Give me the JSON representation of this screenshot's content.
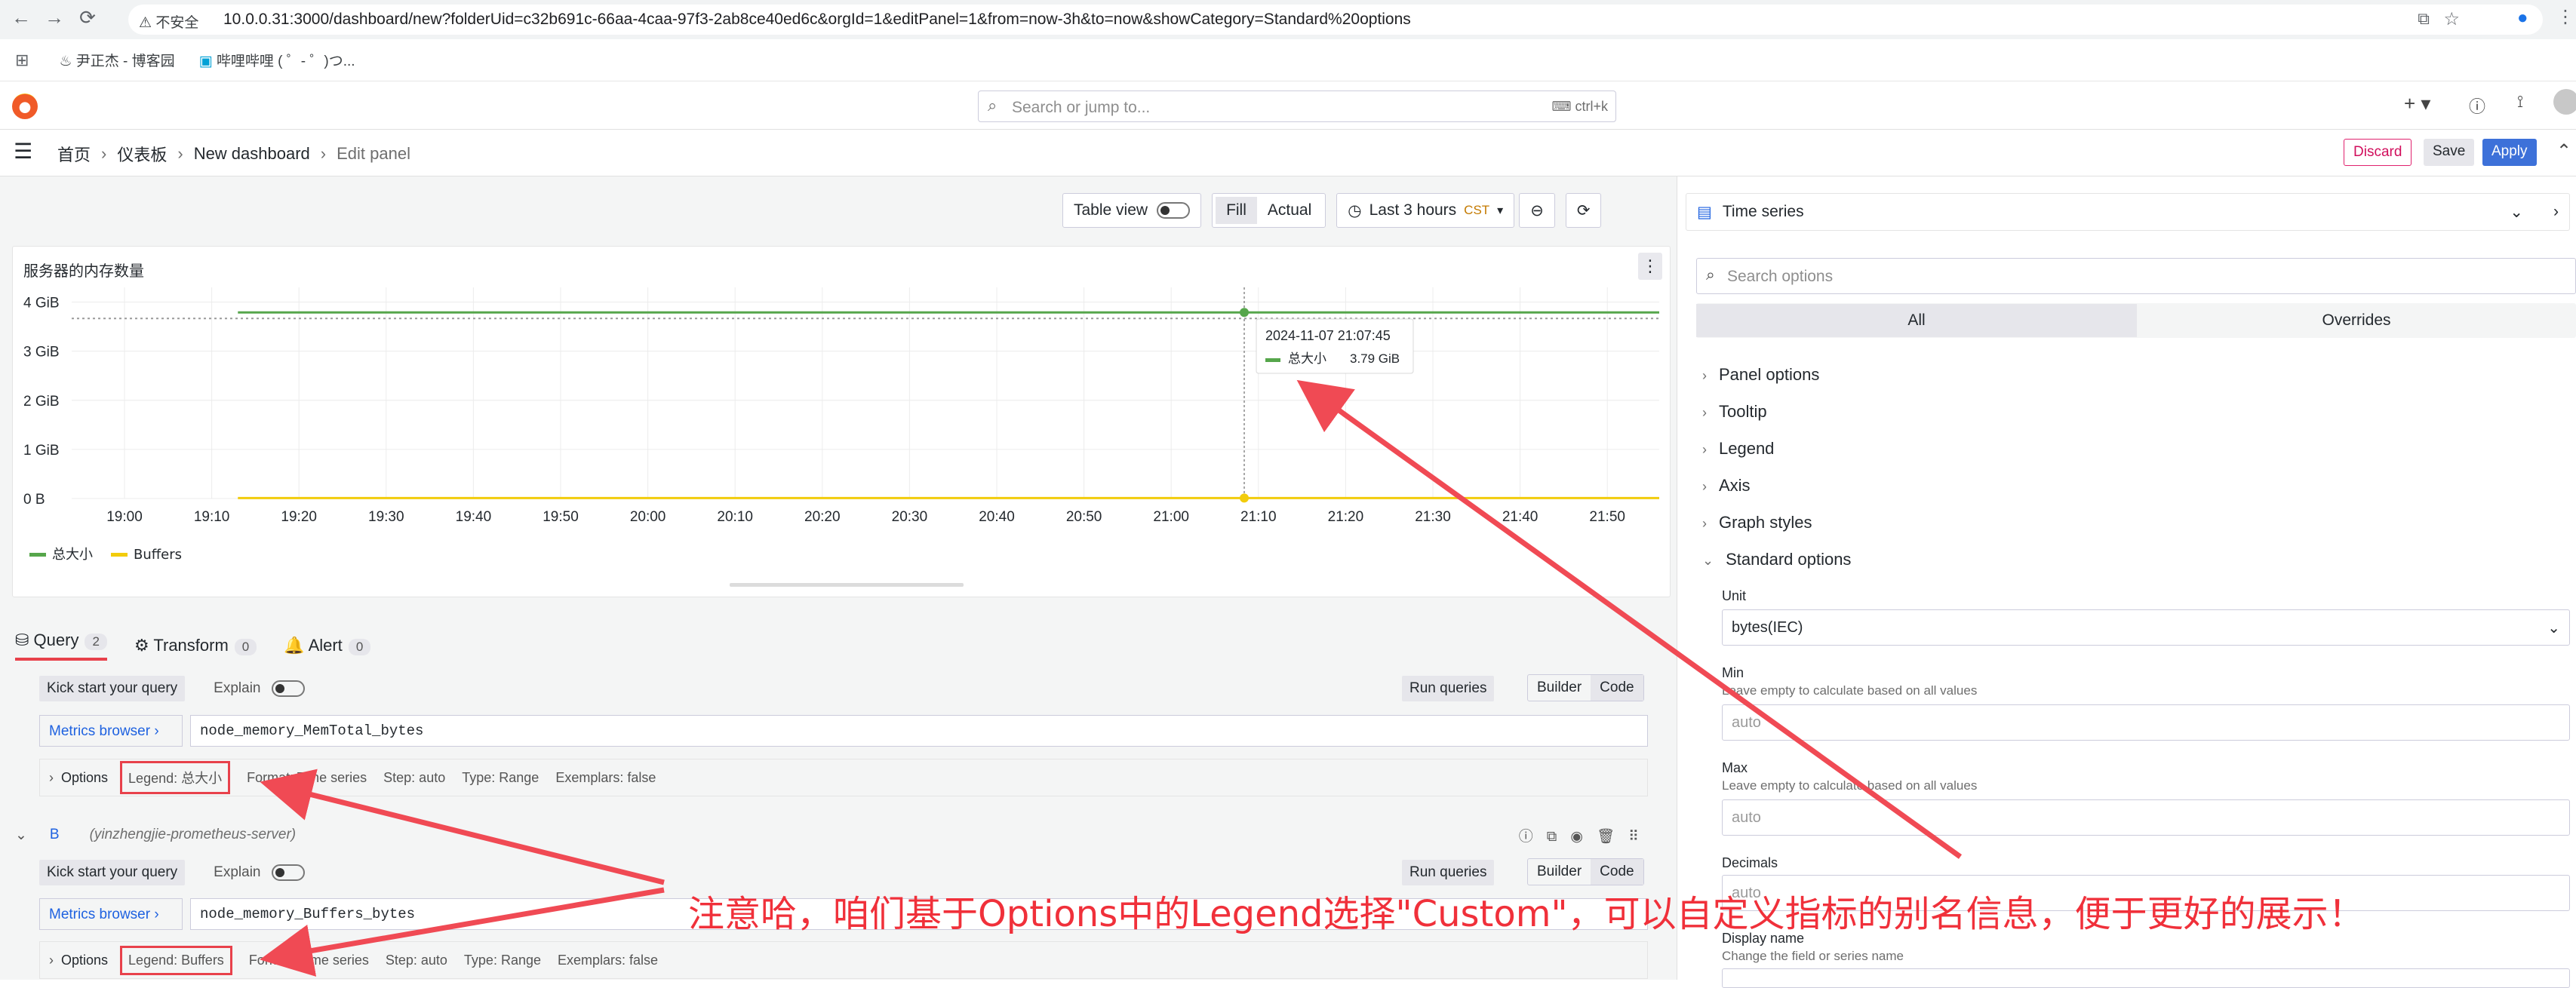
{
  "browser": {
    "secure_label": "不安全",
    "url": "10.0.0.31:3000/dashboard/new?folderUid=c32b691c-66aa-4caa-97f3-2ab8ce40ed6c&orgId=1&editPanel=1&from=now-3h&to=now&showCategory=Standard%20options",
    "bookmarks": [
      "尹正杰 - 博客园",
      "哔哩哔哩 ( ゜- ゜)つ..."
    ]
  },
  "topbar": {
    "search_placeholder": "Search or jump to...",
    "search_shortcut": "ctrl+k",
    "plus_label": "+"
  },
  "breadcrumbs": [
    "首页",
    "仪表板",
    "New dashboard",
    "Edit panel"
  ],
  "actions": {
    "discard": "Discard",
    "save": "Save",
    "apply": "Apply"
  },
  "toolbar": {
    "table_view": "Table view",
    "fill": "Fill",
    "actual": "Actual",
    "time_range": "Last 3 hours",
    "timezone": "CST"
  },
  "panel": {
    "title": "服务器的内存数量"
  },
  "tooltip": {
    "time": "2024-11-07 21:07:45",
    "series": "总大小",
    "value": "3.79 GiB"
  },
  "chart_data": {
    "type": "line",
    "x": [
      "19:00",
      "19:10",
      "19:20",
      "19:30",
      "19:40",
      "19:50",
      "20:00",
      "20:10",
      "20:20",
      "20:30",
      "20:40",
      "20:50",
      "21:00",
      "21:10",
      "21:20",
      "21:30",
      "21:40",
      "21:50"
    ],
    "y_ticks": [
      "0 B",
      "1 GiB",
      "2 GiB",
      "3 GiB",
      "4 GiB"
    ],
    "ylim": [
      0,
      4.3
    ],
    "series": [
      {
        "name": "总大小",
        "color": "#56a64b",
        "value_gib": 3.79
      },
      {
        "name": "Buffers",
        "color": "#f2cc0c",
        "value_gib": 0.01
      }
    ],
    "legend": "bottom-left"
  },
  "query": {
    "tabs": [
      {
        "label": "Query",
        "count": "2"
      },
      {
        "label": "Transform",
        "count": "0"
      },
      {
        "label": "Alert",
        "count": "0"
      }
    ],
    "kick_start": "Kick start your query",
    "explain": "Explain",
    "run": "Run queries",
    "builder": "Builder",
    "code": "Code",
    "metrics_browser": "Metrics browser ›",
    "queries": [
      {
        "expr": "node_memory_MemTotal_bytes",
        "options_label": "Options",
        "legend": "Legend: 总大小",
        "format": "Format: Time series",
        "step": "Step: auto",
        "type": "Type: Range",
        "exemplars": "Exemplars: false"
      },
      {
        "ref": "B",
        "datasource": "(yinzhengjie-prometheus-server)",
        "expr": "node_memory_Buffers_bytes",
        "options_label": "Options",
        "legend": "Legend: Buffers",
        "format": "Format: Time series",
        "step": "Step: auto",
        "type": "Type: Range",
        "exemplars": "Exemplars: false"
      }
    ]
  },
  "options": {
    "viz_type": "Time series",
    "search_placeholder": "Search options",
    "tab_all": "All",
    "tab_overrides": "Overrides",
    "sections": [
      "Panel options",
      "Tooltip",
      "Legend",
      "Axis",
      "Graph styles",
      "Standard options"
    ],
    "unit_label": "Unit",
    "unit_value": "bytes(IEC)",
    "min_label": "Min",
    "min_help": "Leave empty to calculate based on all values",
    "min_placeholder": "auto",
    "max_label": "Max",
    "max_help": "Leave empty to calculate based on all values",
    "max_placeholder": "auto",
    "decimals_label": "Decimals",
    "decimals_placeholder": "auto",
    "display_name_label": "Display name",
    "display_name_help": "Change the field or series name"
  },
  "annotation": "注意哈，咱们基于Options中的Legend选择\"Custom\"，可以自定义指标的别名信息，便于更好的展示！"
}
